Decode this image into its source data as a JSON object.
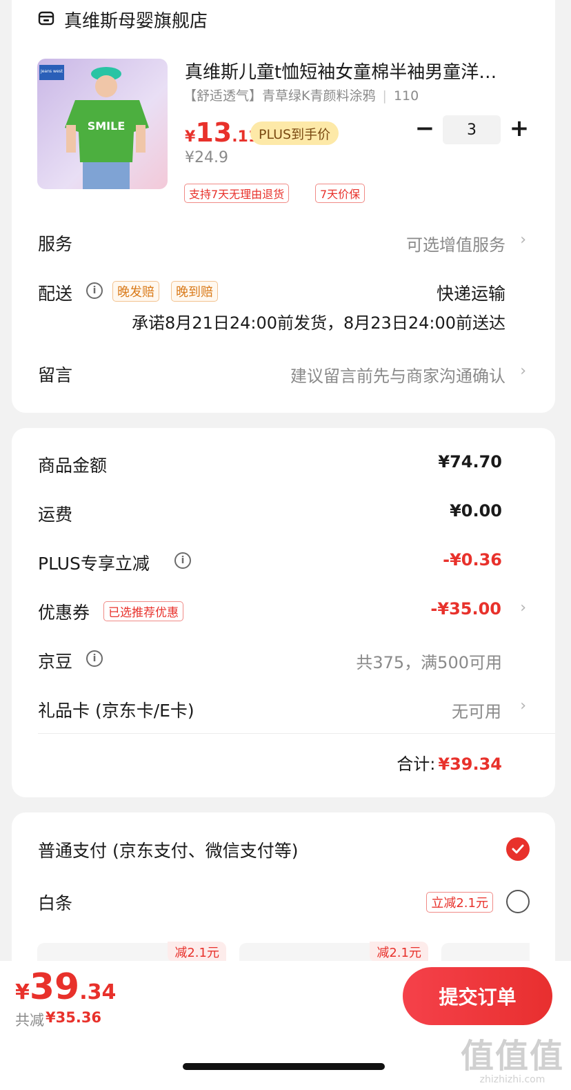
{
  "store": {
    "name": "真维斯母婴旗舰店",
    "icon": "store-icon"
  },
  "product": {
    "title": "真维斯儿童t恤短袖女童棉半袖男童洋…",
    "spec": "【舒适透气】青草绿K青颜料涂鸦",
    "size": "110",
    "price_symbol": "¥",
    "price_int": "13",
    "price_dec": ".11",
    "plus_badge": "PLUS到手价",
    "orig_price": "¥24.9",
    "qty": "3",
    "qty_minus": "−",
    "qty_plus": "+",
    "tags": [
      "支持7天无理由退货",
      "7天价保"
    ],
    "image": {
      "brand_text": "Jeans west",
      "shirt_text": "SMILE",
      "shirt_color": "#4caf3f"
    }
  },
  "service": {
    "label": "服务",
    "value": "可选增值服务"
  },
  "delivery": {
    "label": "配送",
    "tags": [
      "晚发赔",
      "晚到赔"
    ],
    "method": "快递运输",
    "promise": "承诺8月21日24:00前发货，8月23日24:00前送达"
  },
  "message": {
    "label": "留言",
    "placeholder": "建议留言前先与商家沟通确认"
  },
  "summary": {
    "goods_label": "商品金额",
    "goods_value": "¥74.70",
    "shipping_label": "运费",
    "shipping_value": "¥0.00",
    "plus_label": "PLUS专享立减",
    "plus_value": "-¥0.36",
    "coupon_label": "优惠券",
    "coupon_tag": "已选推荐优惠",
    "coupon_value": "-¥35.00",
    "jingdou_label": "京豆",
    "jingdou_value": "共375，满500可用",
    "giftcard_label": "礼品卡 (京东卡/E卡)",
    "giftcard_value": "无可用",
    "total_label": "合计:",
    "total_value": "¥39.34"
  },
  "payment": {
    "normal_label": "普通支付 (京东支付、微信支付等)",
    "baitiao_label": "白条",
    "baitiao_tag": "立减2.1元",
    "plan_tags": [
      "减2.1元",
      "减2.1元"
    ]
  },
  "bottom": {
    "price_symbol": "¥",
    "price_int": "39",
    "price_dec": ".34",
    "saved_label": "共减",
    "saved_value": "¥35.36",
    "submit": "提交订单"
  },
  "watermark": "值值值 zhizhizhi.com",
  "colors": {
    "accent": "#e8312b",
    "plus_badge_bg": "#fde9a8",
    "page_bg": "#f2f2f2"
  }
}
